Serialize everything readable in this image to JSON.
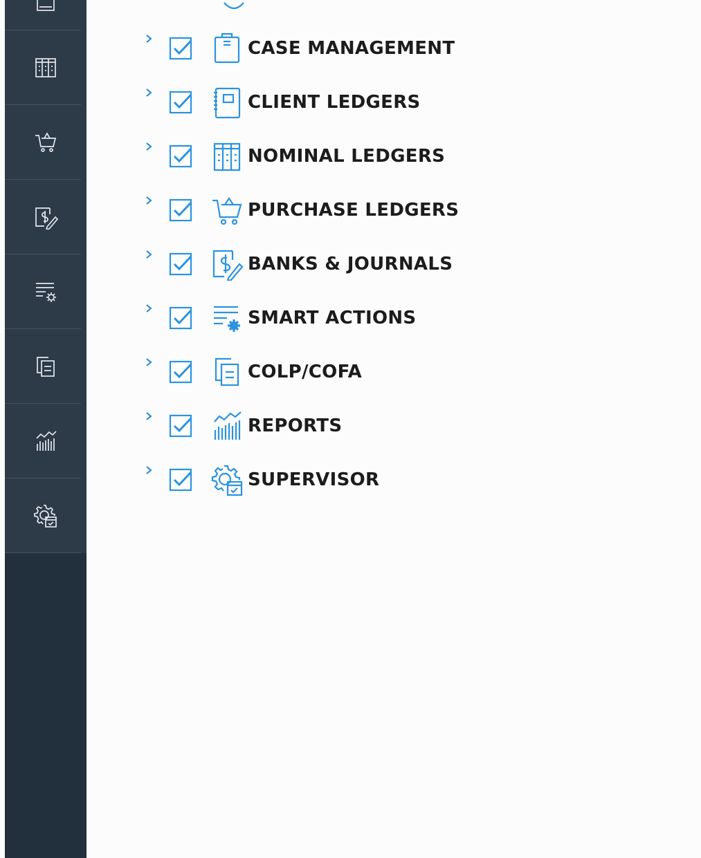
{
  "sidebar": {
    "items": [
      {
        "icon": "doc-partial-icon"
      },
      {
        "icon": "nominal-ledger-icon"
      },
      {
        "icon": "shopping-cart-icon"
      },
      {
        "icon": "banks-journal-icon"
      },
      {
        "icon": "smart-actions-icon"
      },
      {
        "icon": "colp-cofa-icon"
      },
      {
        "icon": "reports-chart-icon"
      },
      {
        "icon": "supervisor-gear-icon"
      }
    ]
  },
  "tree": {
    "items": [
      {
        "label": "CASE MANAGEMENT",
        "checked": true,
        "icon": "case-management-icon"
      },
      {
        "label": "CLIENT LEDGERS",
        "checked": true,
        "icon": "client-ledger-icon"
      },
      {
        "label": "NOMINAL LEDGERS",
        "checked": true,
        "icon": "nominal-ledger-icon"
      },
      {
        "label": "PURCHASE LEDGERS",
        "checked": true,
        "icon": "shopping-cart-icon"
      },
      {
        "label": "BANKS & JOURNALS",
        "checked": true,
        "icon": "banks-journal-icon"
      },
      {
        "label": "SMART ACTIONS",
        "checked": true,
        "icon": "smart-actions-icon"
      },
      {
        "label": "COLP/COFA",
        "checked": true,
        "icon": "colp-cofa-icon"
      },
      {
        "label": "REPORTS",
        "checked": true,
        "icon": "reports-chart-icon"
      },
      {
        "label": "SUPERVISOR",
        "checked": true,
        "icon": "supervisor-gear-icon"
      }
    ]
  },
  "colors": {
    "sidebar_bg": "#222f3c",
    "sidebar_block": "#2d3a48",
    "accent": "#2b93df",
    "chevron": "#1e88d8",
    "label": "#1c1c1c"
  }
}
